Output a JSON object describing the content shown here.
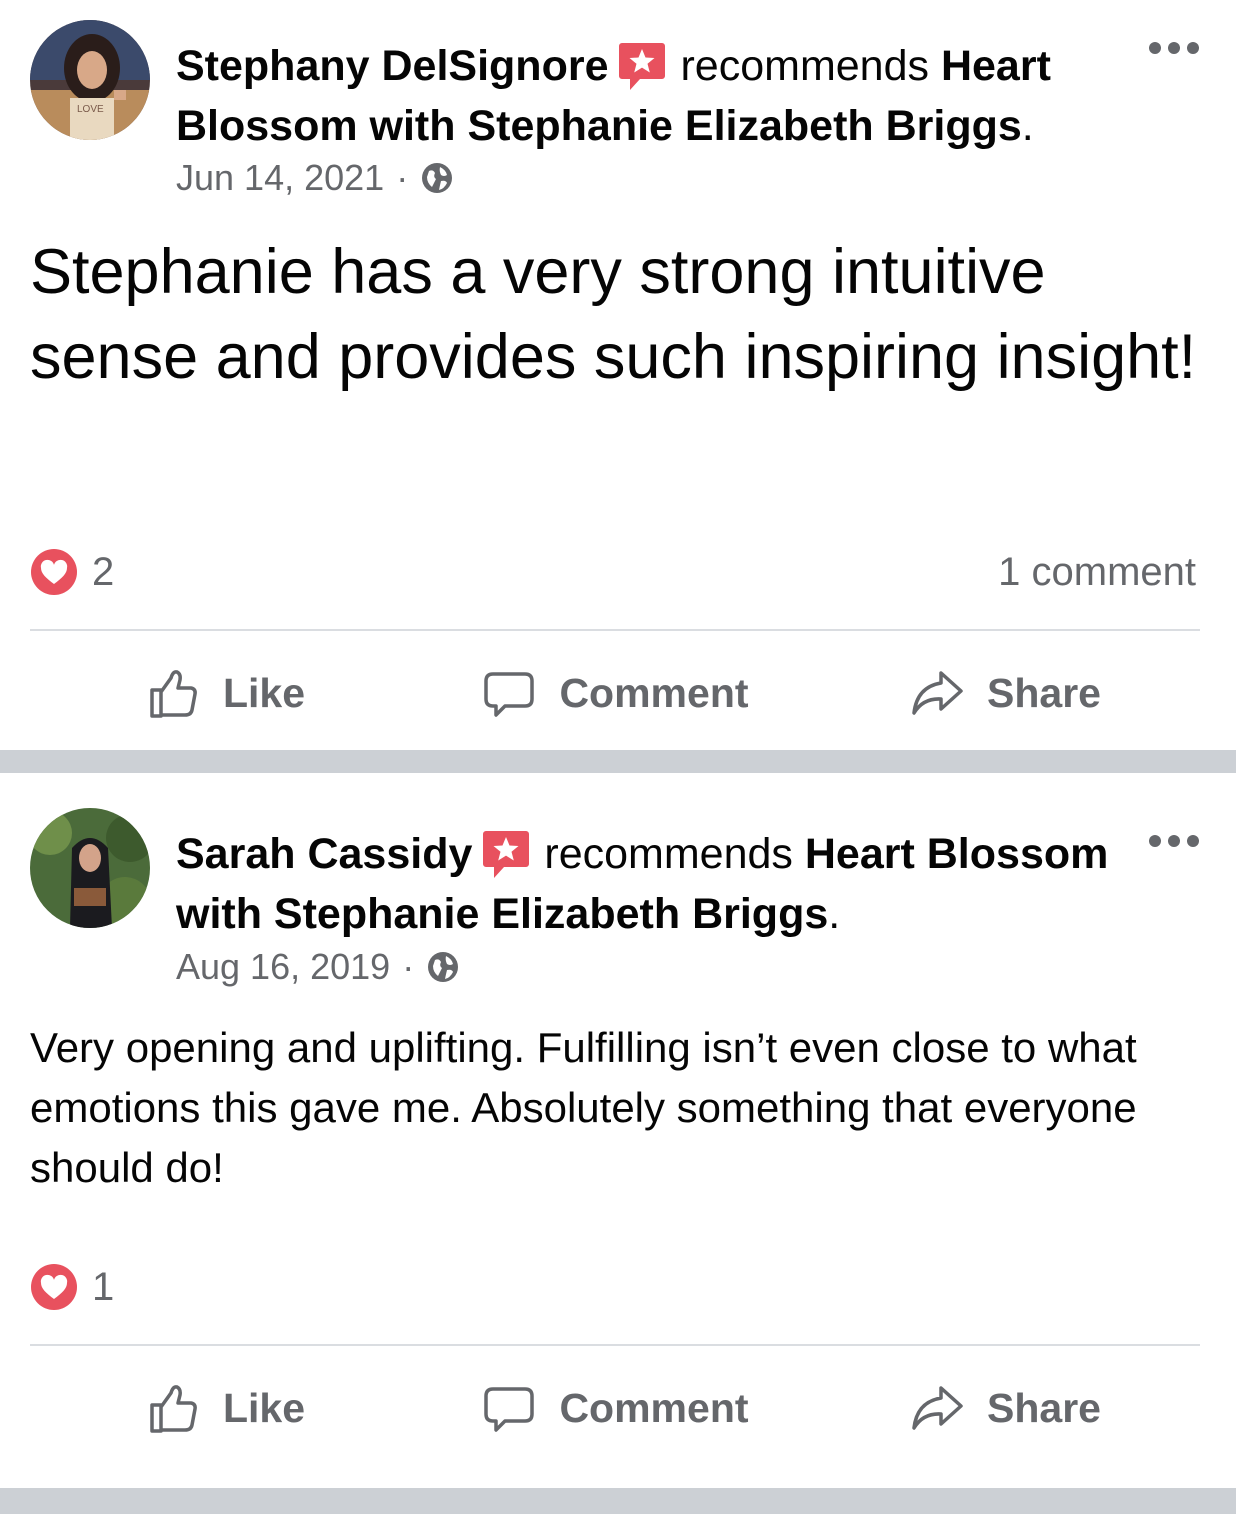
{
  "posts": [
    {
      "author": "Stephany DelSignore",
      "action_text": "recommends",
      "page_name": "Heart Blossom with Stephanie Elizabeth Briggs",
      "trailing_punct": ".",
      "date": "Jun 14, 2021",
      "audience_icon": "globe-icon",
      "body": "Stephanie has a very strong intuitive sense and provides such inspiring insight!",
      "reaction_icon": "heart-icon",
      "reaction_count": "2",
      "comment_count": "1 comment"
    },
    {
      "author": "Sarah Cassidy",
      "action_text": "recommends",
      "page_name": "Heart Blossom with Stephanie Elizabeth Briggs",
      "trailing_punct": ".",
      "date": "Aug 16, 2019",
      "audience_icon": "globe-icon",
      "body": "Very opening and uplifting. Fulfilling isn’t even close to what emotions this gave me. Absolutely something that everyone should do!",
      "reaction_icon": "heart-icon",
      "reaction_count": "1",
      "comment_count": ""
    }
  ],
  "actions": {
    "like": "Like",
    "comment": "Comment",
    "share": "Share"
  },
  "colors": {
    "recommend_badge": "#e8515e",
    "heart_badge": "#e8515e",
    "secondary_text": "#65676b",
    "separator": "#ccd0d5"
  },
  "meta_separator": "·"
}
